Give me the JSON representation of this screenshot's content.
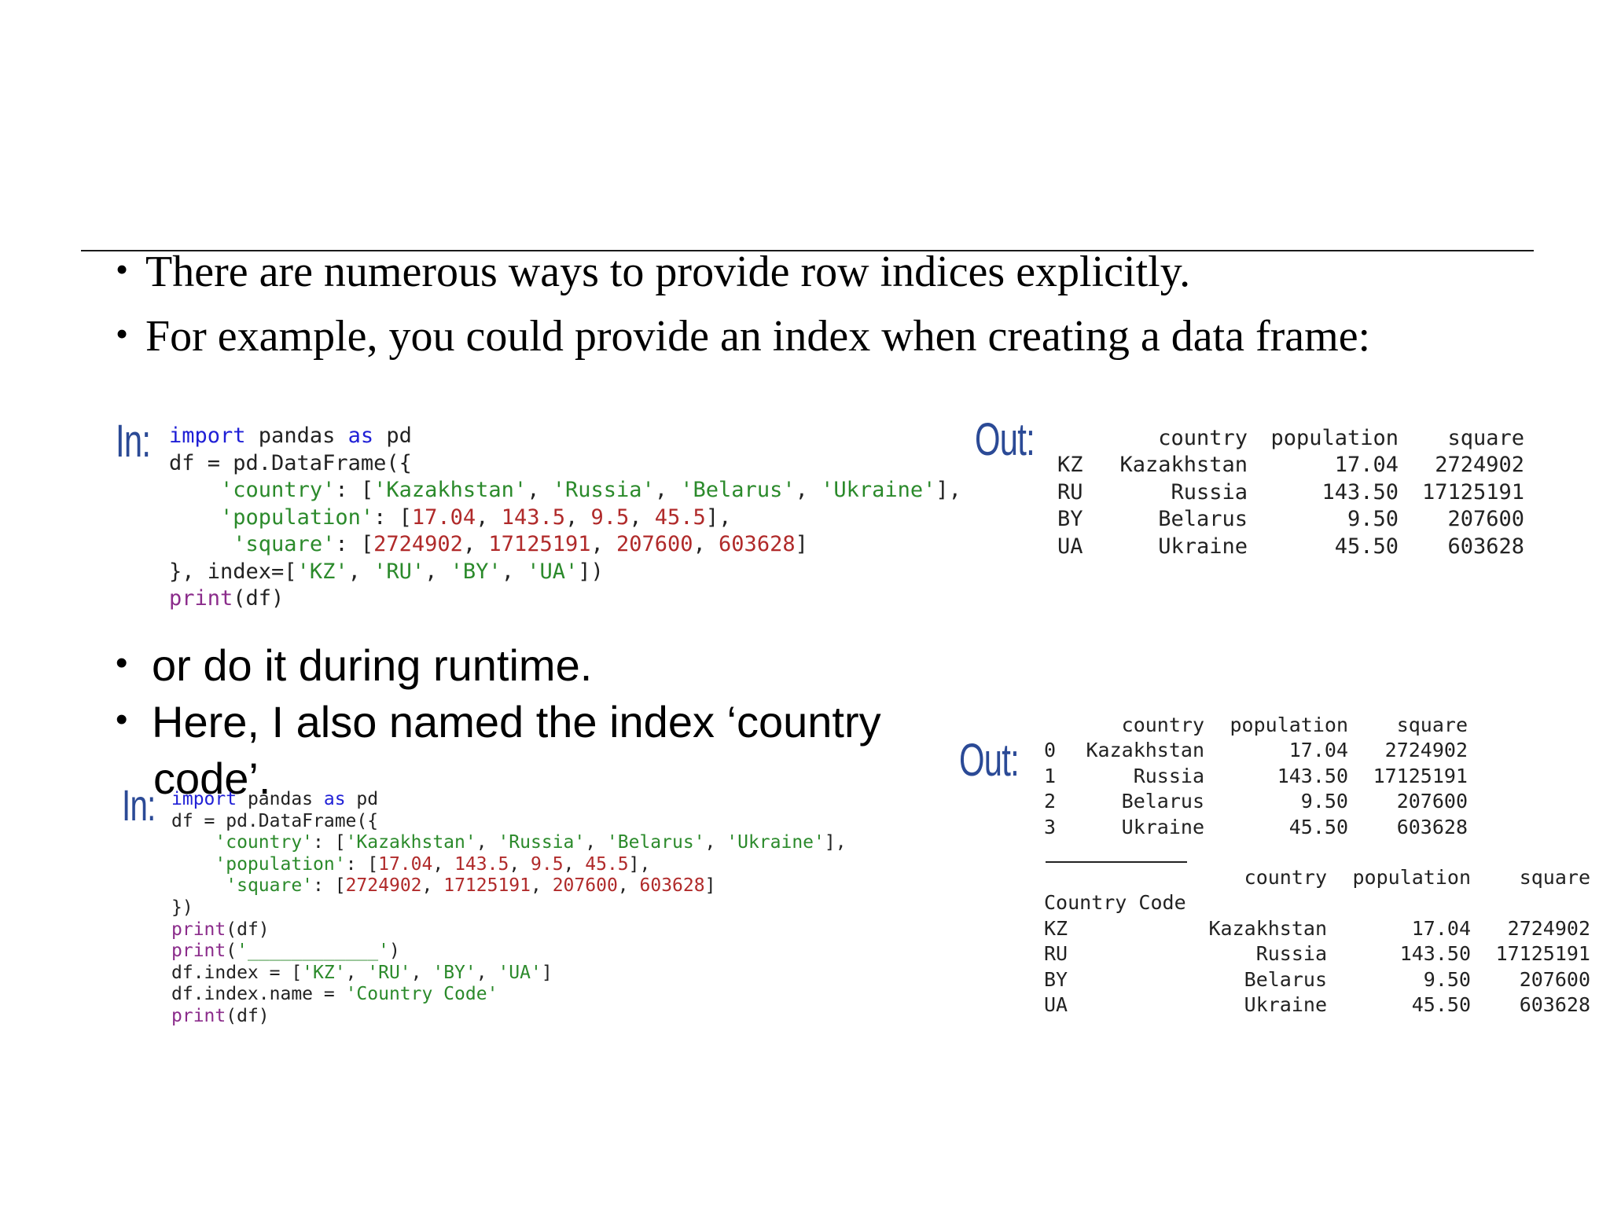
{
  "bullets_top": [
    "There are numerous ways to provide row indices explicitly.",
    "For example, you could provide an index when creating a data frame:"
  ],
  "bullets_bottom": [
    "or do it during runtime.",
    "Here, I also named the index ‘country code’."
  ],
  "prompts": {
    "in": "In:",
    "out": "Out:"
  },
  "code1": {
    "l1": {
      "k1": "import",
      "t1": " pandas ",
      "k2": "as",
      "t2": " pd"
    },
    "l2": "df = pd.DataFrame({",
    "l3": {
      "t1": "    ",
      "s1": "'country'",
      "t2": ": [",
      "s2": "'Kazakhstan'",
      "t3": ", ",
      "s3": "'Russia'",
      "t4": ", ",
      "s4": "'Belarus'",
      "t5": ", ",
      "s5": "'Ukraine'",
      "t6": "],"
    },
    "l4": {
      "t1": "    ",
      "s1": "'population'",
      "t2": ": [",
      "n1": "17.04",
      "t3": ", ",
      "n2": "143.5",
      "t4": ", ",
      "n3": "9.5",
      "t5": ", ",
      "n4": "45.5",
      "t6": "],"
    },
    "l5": {
      "t1": "     ",
      "s1": "'square'",
      "t2": ": [",
      "n1": "2724902",
      "t3": ", ",
      "n2": "17125191",
      "t4": ", ",
      "n3": "207600",
      "t5": ", ",
      "n4": "603628",
      "t6": "]"
    },
    "l6": {
      "t1": "}, index=[",
      "s1": "'KZ'",
      "t2": ", ",
      "s2": "'RU'",
      "t3": ", ",
      "s3": "'BY'",
      "t4": ", ",
      "s4": "'UA'",
      "t5": "])"
    },
    "l7": {
      "f1": "print",
      "t1": "(df)"
    }
  },
  "code2": {
    "l1": {
      "k1": "import",
      "t1": " pandas ",
      "k2": "as",
      "t2": " pd"
    },
    "l2": "df = pd.DataFrame({",
    "l3": {
      "t1": "    ",
      "s1": "'country'",
      "t2": ": [",
      "s2": "'Kazakhstan'",
      "t3": ", ",
      "s3": "'Russia'",
      "t4": ", ",
      "s4": "'Belarus'",
      "t5": ", ",
      "s5": "'Ukraine'",
      "t6": "],"
    },
    "l4": {
      "t1": "    ",
      "s1": "'population'",
      "t2": ": [",
      "n1": "17.04",
      "t3": ", ",
      "n2": "143.5",
      "t4": ", ",
      "n3": "9.5",
      "t5": ", ",
      "n4": "45.5",
      "t6": "],"
    },
    "l5": {
      "t1": "     ",
      "s1": "'square'",
      "t2": ": [",
      "n1": "2724902",
      "t3": ", ",
      "n2": "17125191",
      "t4": ", ",
      "n3": "207600",
      "t5": ", ",
      "n4": "603628",
      "t6": "]"
    },
    "l6": "})",
    "l7": {
      "f1": "print",
      "t1": "(df)"
    },
    "l8": {
      "f1": "print",
      "t1": "(",
      "s1": "'____________'",
      "t2": ")"
    },
    "l9": {
      "t1": "df.index = [",
      "s1": "'KZ'",
      "t2": ", ",
      "s2": "'RU'",
      "t3": ", ",
      "s3": "'BY'",
      "t4": ", ",
      "s4": "'UA'",
      "t5": "]"
    },
    "l10": {
      "t1": "df.index.name = ",
      "s1": "'Country Code'"
    },
    "l11": {
      "f1": "print",
      "t1": "(df)"
    }
  },
  "out1": {
    "headers": [
      "",
      "country",
      "population",
      "square"
    ],
    "rows": [
      [
        "KZ",
        "Kazakhstan",
        "17.04",
        "2724902"
      ],
      [
        "RU",
        "Russia",
        "143.50",
        "17125191"
      ],
      [
        "BY",
        "Belarus",
        "9.50",
        "207600"
      ],
      [
        "UA",
        "Ukraine",
        "45.50",
        "603628"
      ]
    ]
  },
  "out2a": {
    "headers": [
      "",
      "country",
      "population",
      "square"
    ],
    "rows": [
      [
        "0",
        "Kazakhstan",
        "17.04",
        "2724902"
      ],
      [
        "1",
        "Russia",
        "143.50",
        "17125191"
      ],
      [
        "2",
        "Belarus",
        "9.50",
        "207600"
      ],
      [
        "3",
        "Ukraine",
        "45.50",
        "603628"
      ]
    ]
  },
  "out2b": {
    "headers": [
      "",
      "country",
      "population",
      "square"
    ],
    "index_name": "Country Code",
    "rows": [
      [
        "KZ",
        "Kazakhstan",
        "17.04",
        "2724902"
      ],
      [
        "RU",
        "Russia",
        "143.50",
        "17125191"
      ],
      [
        "BY",
        "Belarus",
        "9.50",
        "207600"
      ],
      [
        "UA",
        "Ukraine",
        "45.50",
        "603628"
      ]
    ]
  }
}
